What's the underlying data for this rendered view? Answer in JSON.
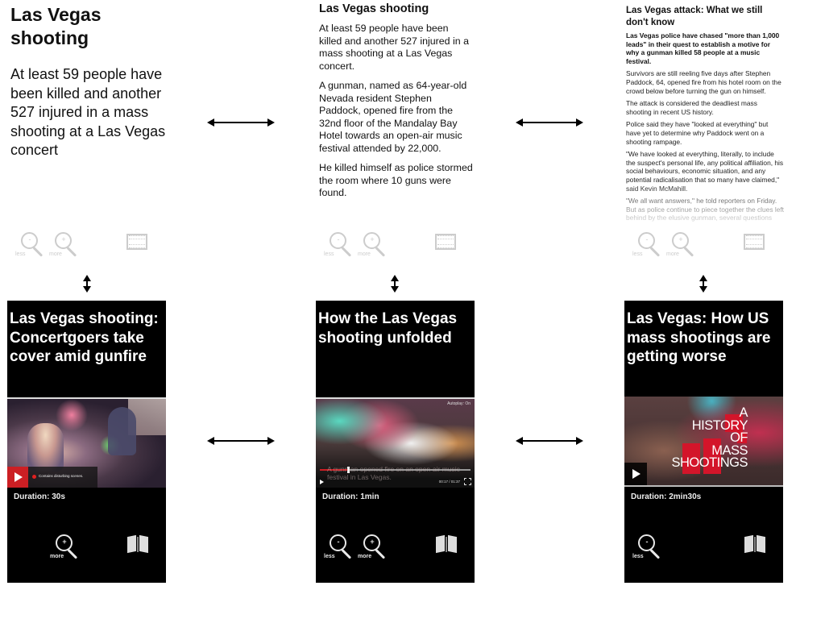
{
  "panels_text": [
    {
      "title": "Las Vegas shooting",
      "paragraphs": [
        "At least 59 people have been killed and another 527 injured in a mass shooting at a Las Vegas concert"
      ]
    },
    {
      "title": "Las Vegas shooting",
      "paragraphs": [
        "At least 59 people have been killed and another 527 injured in a mass shooting at a Las Vegas concert.",
        "A gunman, named as 64-year-old Nevada resident Stephen Paddock, opened fire from the 32nd floor of the Mandalay Bay Hotel towards an open-air music festival attended by 22,000.",
        "He killed himself as police stormed the room where 10 guns were found."
      ]
    },
    {
      "title": "Las Vegas attack: What we still don't know",
      "lead": "Las Vegas police have chased \"more than 1,000 leads\" in their quest to establish a motive for why a gunman killed 58 people at a music festival.",
      "paragraphs": [
        "Survivors are still reeling five days after Stephen Paddock, 64, opened fire from his hotel room on the crowd below before turning the gun on himself.",
        "The attack is considered the deadliest mass shooting in recent US history.",
        "Police said they have \"looked at everything\" but have yet to determine why Paddock went on a shooting rampage.",
        "\"We have looked at everything, literally, to include the suspect's personal life, any political affiliation, his social behaviours, economic situation, and any potential radicalisation that so many have claimed,\" said Kevin McMahill.",
        "\"We all want answers,\" he told reporters on Friday. But as police continue to piece together the clues left behind by the elusive gunman, several questions remain unanswered, including"
      ]
    }
  ],
  "icons": {
    "less_label": "less",
    "more_label": "more",
    "minus": "-",
    "plus": "+"
  },
  "videos": [
    {
      "title": "Las Vegas shooting: Concertgoers take cover amid gunfire",
      "duration": "Duration: 30s",
      "warning": "Contains disturbing scenes."
    },
    {
      "title": "How the Las Vegas shooting unfolded",
      "duration": "Duration: 1min",
      "autoplay": "Autoplay: On",
      "subtitle": "A gunman opened fire on an open-air music festival in Las Vegas.",
      "time": "00:17 / 01:37",
      "progress": 0.18
    },
    {
      "title": "Las Vegas: How US mass shootings are getting worse",
      "duration": "Duration: 2min30s",
      "overlay_lines": [
        "A",
        "HISTORY",
        "OF",
        "MASS",
        "SHOOTINGS"
      ]
    }
  ],
  "colors": {
    "accent_red": "#cc1f24",
    "icon_grey": "#cccccc",
    "card_bg": "#000000"
  }
}
